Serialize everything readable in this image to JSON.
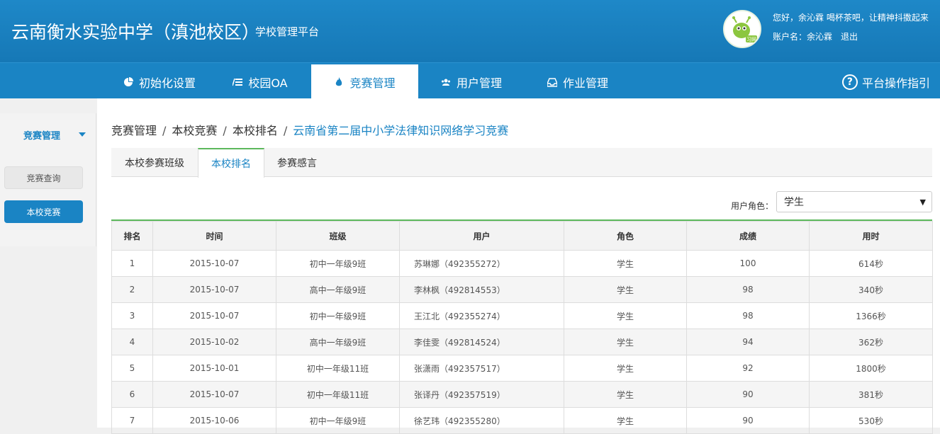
{
  "header": {
    "title": "云南衡水实验中学（滇池校区）",
    "subtitle": "学校管理平台",
    "greeting": "您好，余沁霖 喝杯茶吧，让精神抖擞起来",
    "account_label": "账户名：余沁霖",
    "logout": "退出",
    "avatar_text": "习网"
  },
  "nav": {
    "items": [
      {
        "label": "初始化设置",
        "icon": "pie-chart-icon"
      },
      {
        "label": "校园OA",
        "icon": "list-icon"
      },
      {
        "label": "竞赛管理",
        "icon": "flame-icon"
      },
      {
        "label": "用户管理",
        "icon": "users-icon"
      },
      {
        "label": "作业管理",
        "icon": "inbox-icon"
      }
    ],
    "active_index": 2,
    "help": "平台操作指引"
  },
  "sidebar": {
    "heading": "竞赛管理",
    "items": [
      "竞赛查询",
      "本校竞赛"
    ],
    "active_index": 1
  },
  "breadcrumb": [
    "竞赛管理",
    "本校竞赛",
    "本校排名",
    "云南省第二届中小学法律知识网络学习竞赛"
  ],
  "tabs": {
    "items": [
      "本校参赛班级",
      "本校排名",
      "参赛感言"
    ],
    "active_index": 1
  },
  "filter": {
    "label": "用户角色：",
    "value": "学生"
  },
  "table": {
    "headers": [
      "排名",
      "时间",
      "班级",
      "用户",
      "角色",
      "成绩",
      "用时"
    ],
    "rows": [
      [
        "1",
        "2015-10-07",
        "初中一年级9班",
        "苏琳娜（492355272）",
        "学生",
        "100",
        "614秒"
      ],
      [
        "2",
        "2015-10-07",
        "高中一年级9班",
        "李林枫（492814553）",
        "学生",
        "98",
        "340秒"
      ],
      [
        "3",
        "2015-10-07",
        "初中一年级9班",
        "王江北（492355274）",
        "学生",
        "98",
        "1366秒"
      ],
      [
        "4",
        "2015-10-02",
        "高中一年级9班",
        "李佳雯（492814524）",
        "学生",
        "94",
        "362秒"
      ],
      [
        "5",
        "2015-10-01",
        "初中一年级11班",
        "张潇雨（492357517）",
        "学生",
        "92",
        "1800秒"
      ],
      [
        "6",
        "2015-10-07",
        "初中一年级11班",
        "张译丹（492357519）",
        "学生",
        "90",
        "381秒"
      ],
      [
        "7",
        "2015-10-06",
        "初中一年级9班",
        "徐艺玮（492355280）",
        "学生",
        "90",
        "530秒"
      ]
    ]
  },
  "colors": {
    "primary": "#1a84c4",
    "accent_green": "#5cb85c",
    "header_bg": "#1e88c8"
  }
}
